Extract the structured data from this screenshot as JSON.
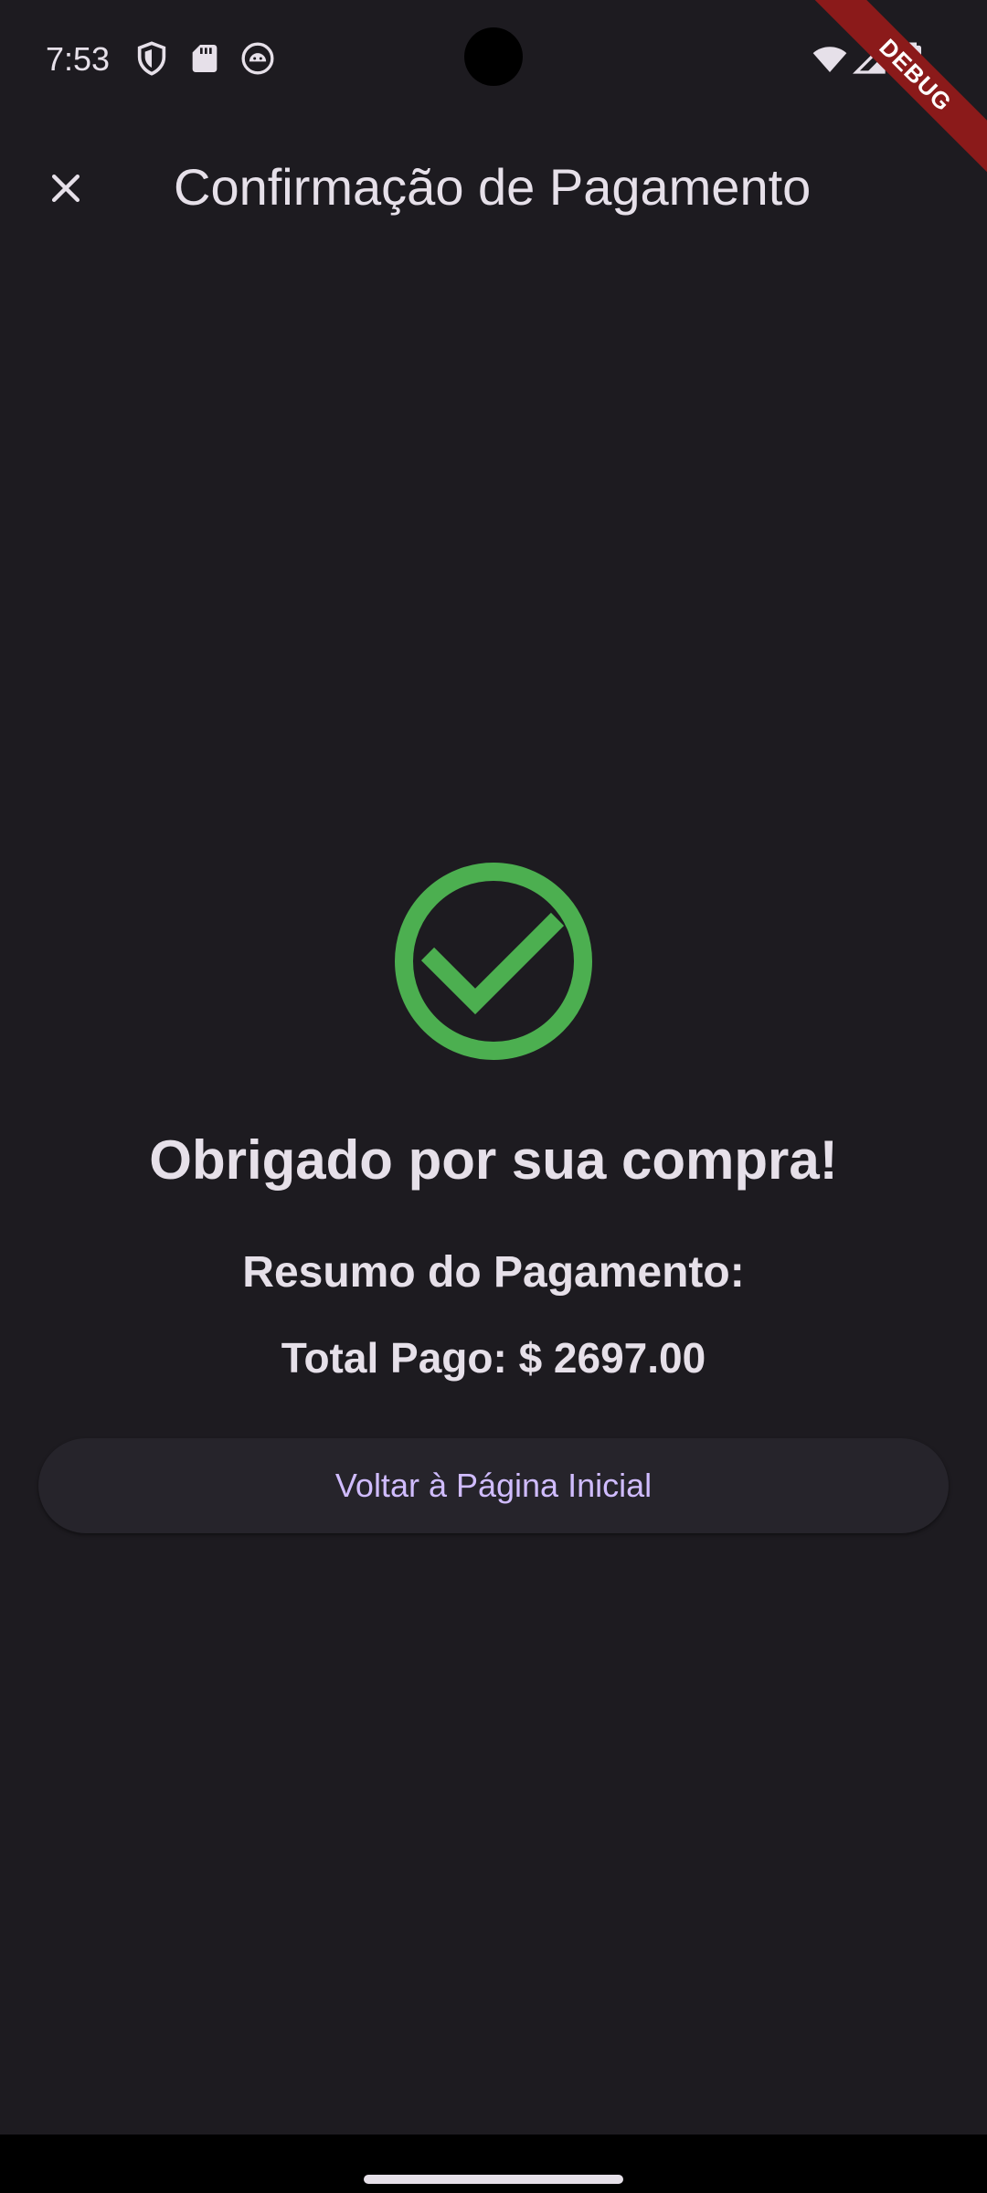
{
  "status_bar": {
    "time": "7:53",
    "left_icons": [
      "shield-icon",
      "sd-card-icon",
      "android-debug-icon"
    ],
    "right_icons": [
      "wifi-icon",
      "cellular-signal-icon",
      "battery-icon"
    ]
  },
  "debug_banner": "DEBUG",
  "app_bar": {
    "title": "Confirmação de Pagamento",
    "close_icon": "close-icon"
  },
  "content": {
    "success_icon": "check-circle-icon",
    "thanks": "Obrigado por sua compra!",
    "summary_title": "Resumo do Pagamento:",
    "total_paid": "Total Pago: $ 2697.00",
    "home_button_label": "Voltar à Página Inicial"
  },
  "colors": {
    "background": "#1d1b20",
    "text": "#e6e0e9",
    "success": "#4caf50",
    "button_text": "#d0bcff",
    "button_bg": "#26242b",
    "debug_banner": "#8b1a1a"
  }
}
